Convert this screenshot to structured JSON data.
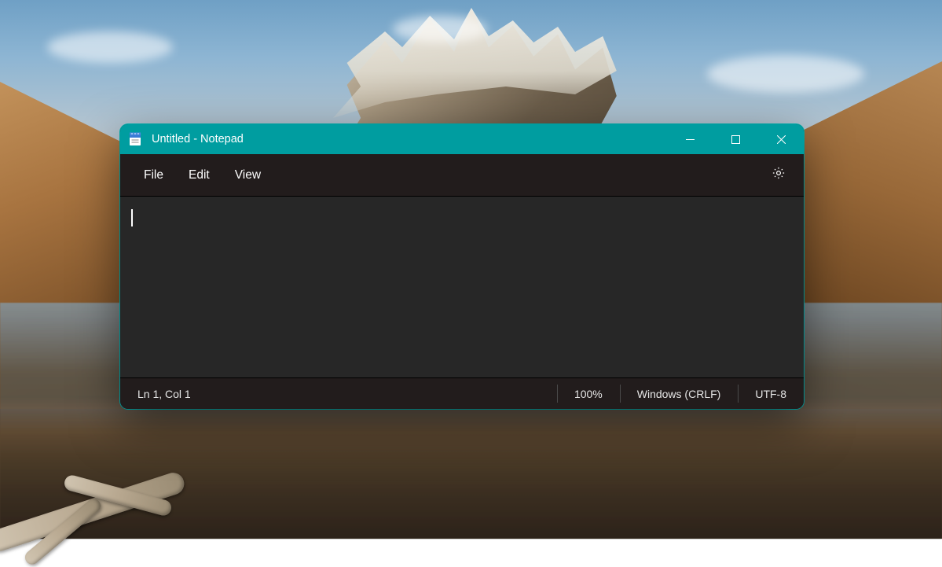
{
  "window": {
    "title": "Untitled - Notepad"
  },
  "menubar": {
    "file": "File",
    "edit": "Edit",
    "view": "View"
  },
  "editor": {
    "content": ""
  },
  "statusbar": {
    "position": "Ln 1, Col 1",
    "zoom": "100%",
    "line_ending": "Windows (CRLF)",
    "encoding": "UTF-8"
  }
}
